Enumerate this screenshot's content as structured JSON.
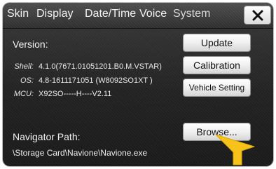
{
  "tabs": [
    {
      "label": "Skin"
    },
    {
      "label": "Display"
    },
    {
      "label": "Date/Time"
    },
    {
      "label": "Voice"
    },
    {
      "label": "System"
    }
  ],
  "active_tab": "System",
  "close_icon": "close-icon",
  "version": {
    "title": "Version:",
    "shell_label": "Shell:",
    "shell_value": "4.1.0(7671.01051201.B0.M.VSTAR)",
    "os_label": "OS:",
    "os_value": "4.8-1611171051 (W8092SO1XT  )",
    "mcu_label": "MCU:",
    "mcu_value": "X92SO-----H----V2.11"
  },
  "buttons": {
    "update": "Update",
    "calibration": "Calibration",
    "vehicle_setting": "Vehicle Setting",
    "browse": "Browse..."
  },
  "navigator": {
    "title": "Navigator Path:",
    "path": "\\Storage Card\\Navione\\Navione.exe"
  },
  "pointer_icon": "arrow-pointer-icon",
  "colors": {
    "pointer": "#f7c21a",
    "background": "#262626"
  }
}
